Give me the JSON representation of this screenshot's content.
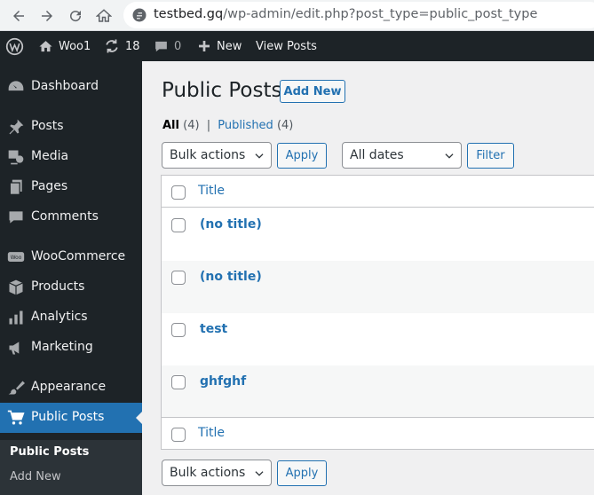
{
  "browser": {
    "url_host": "testbed.gq",
    "url_path": "/wp-admin/edit.php?post_type=public_post_type"
  },
  "adminbar": {
    "site_name": "Woo1",
    "updates_count": "18",
    "comments_count": "0",
    "new_label": "New",
    "view_posts_label": "View Posts"
  },
  "sidebar": {
    "items": [
      {
        "label": "Dashboard",
        "icon": "dashboard-icon"
      },
      {
        "label": "Posts",
        "icon": "pin-icon"
      },
      {
        "label": "Media",
        "icon": "media-icon"
      },
      {
        "label": "Pages",
        "icon": "pages-icon"
      },
      {
        "label": "Comments",
        "icon": "comment-icon"
      },
      {
        "label": "WooCommerce",
        "icon": "woo-icon"
      },
      {
        "label": "Products",
        "icon": "box-icon"
      },
      {
        "label": "Analytics",
        "icon": "bar-chart-icon"
      },
      {
        "label": "Marketing",
        "icon": "megaphone-icon"
      },
      {
        "label": "Appearance",
        "icon": "brush-icon"
      },
      {
        "label": "Public Posts",
        "icon": "cart-icon"
      }
    ],
    "submenu": [
      "Public Posts",
      "Add New"
    ]
  },
  "main": {
    "title": "Public Posts",
    "add_new_label": "Add New",
    "views": {
      "all_label": "All",
      "all_count": "(4)",
      "separator": "|",
      "published_label": "Published",
      "published_count": "(4)"
    },
    "bulk_actions_label": "Bulk actions",
    "apply_label": "Apply",
    "dates_label": "All dates",
    "filter_label": "Filter",
    "table": {
      "column_title": "Title",
      "rows": [
        "(no title)",
        "(no title)",
        "test",
        "ghfghf"
      ]
    }
  },
  "colors": {
    "admin_dark": "#1d2327",
    "accent": "#2271b1",
    "page_bg": "#f0f0f1"
  }
}
